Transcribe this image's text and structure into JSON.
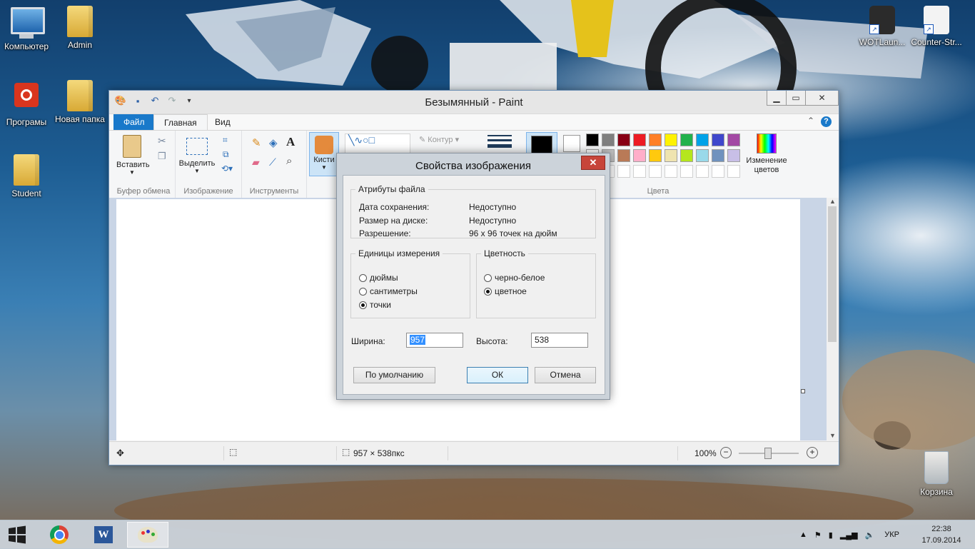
{
  "desktop": {
    "icons": [
      {
        "label": "Компьютер",
        "icon": "computer-icon"
      },
      {
        "label": "Admin",
        "icon": "user-folder-icon"
      },
      {
        "label": "Програмы",
        "icon": "power-icon"
      },
      {
        "label": "Новая папка",
        "icon": "folder-icon"
      },
      {
        "label": "Student",
        "icon": "folder-icon"
      },
      {
        "label": "WOTLaun...",
        "icon": "wot-icon"
      },
      {
        "label": "Counter-Str...",
        "icon": "counter-strike-icon"
      },
      {
        "label": "Корзина",
        "icon": "recycle-bin-icon"
      }
    ]
  },
  "paint": {
    "title": "Безымянный - Paint",
    "tabs": {
      "file": "Файл",
      "home": "Главная",
      "view": "Вид"
    },
    "ribbon": {
      "clipboard": {
        "paste": "Вставить",
        "group": "Буфер обмена"
      },
      "image": {
        "select": "Выделить",
        "group": "Изображение"
      },
      "tools": {
        "group": "Инструменты"
      },
      "brushes": {
        "label": "Кисти"
      },
      "shapes": {
        "outline": "Контур"
      },
      "colors": {
        "group": "Цвета",
        "edit": "Изменение цветов",
        "palette_row1": [
          "#000000",
          "#7f7f7f",
          "#880015",
          "#ed1c24",
          "#ff7f27",
          "#fff200",
          "#22b14c",
          "#00a2e8",
          "#3f48cc",
          "#a349a4"
        ],
        "palette_row2": [
          "#ffffff",
          "#c3c3c3",
          "#b97a57",
          "#ffaec9",
          "#ffc90e",
          "#efe4b0",
          "#b5e61d",
          "#99d9ea",
          "#7092be",
          "#c8bfe7"
        ]
      }
    },
    "status": {
      "size": "957 × 538пкс",
      "zoom": "100%"
    }
  },
  "dialog": {
    "title": "Свойства изображения",
    "file_attrs": {
      "legend": "Атрибуты файла",
      "saved_label": "Дата сохранения:",
      "saved_value": "Недоступно",
      "disk_label": "Размер на диске:",
      "disk_value": "Недоступно",
      "res_label": "Разрешение:",
      "res_value": "96 x 96 точек на дюйм"
    },
    "units": {
      "legend": "Единицы измерения",
      "inches": "дюймы",
      "cm": "сантиметры",
      "pixels": "точки",
      "selected": "pixels"
    },
    "color": {
      "legend": "Цветность",
      "bw": "черно-белое",
      "color": "цветное",
      "selected": "color"
    },
    "width_label": "Ширина:",
    "width_value": "957",
    "height_label": "Высота:",
    "height_value": "538",
    "buttons": {
      "default": "По умолчанию",
      "ok": "ОК",
      "cancel": "Отмена"
    }
  },
  "taskbar": {
    "apps": [
      "start-button",
      "chrome",
      "word",
      "paint"
    ],
    "language": "УКР",
    "time": "22:38",
    "date": "17.09.2014"
  }
}
